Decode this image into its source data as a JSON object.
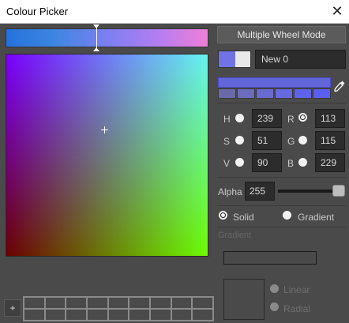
{
  "window": {
    "title": "Colour Picker",
    "close_glyph": "✕"
  },
  "hue_slider": {
    "gradient_colors": [
      "#2472dc",
      "#7c7ff0",
      "#f07ed6"
    ]
  },
  "sv_square": {
    "top_left": "#7a00ff",
    "top_right": "#66f7f0",
    "bottom_left": "#6a0000",
    "bottom_right": "#6cff00"
  },
  "mode_button": {
    "label": "Multiple Wheel Mode"
  },
  "current_color": {
    "new_hex": "#7173e5",
    "old_hex": "#e9e9e9"
  },
  "name_field": {
    "value": "New 0"
  },
  "palette": {
    "main_color": "#6366d9",
    "shades": [
      "#6a6aa8",
      "#6c6cbe",
      "#6a6bd2",
      "#6669e0",
      "#5f63ec",
      "#5a5ff4"
    ]
  },
  "eyedropper": {
    "icon": "eyedropper-icon",
    "glyph": "🖉"
  },
  "hsv": {
    "h": {
      "label": "H",
      "value": "239"
    },
    "s": {
      "label": "S",
      "value": "51"
    },
    "v": {
      "label": "V",
      "value": "90"
    }
  },
  "rgb": {
    "r": {
      "label": "R",
      "value": "113"
    },
    "g": {
      "label": "G",
      "value": "115"
    },
    "b": {
      "label": "B",
      "value": "229"
    }
  },
  "alpha": {
    "label": "Alpha",
    "value": "255"
  },
  "fill_mode": {
    "solid_label": "Solid",
    "gradient_label": "Gradient",
    "selected": "solid"
  },
  "gradient_section": {
    "heading": "Gradient",
    "linear_label": "Linear",
    "radial_label": "Radial"
  },
  "saved_swatches": {
    "add_label": "+"
  }
}
